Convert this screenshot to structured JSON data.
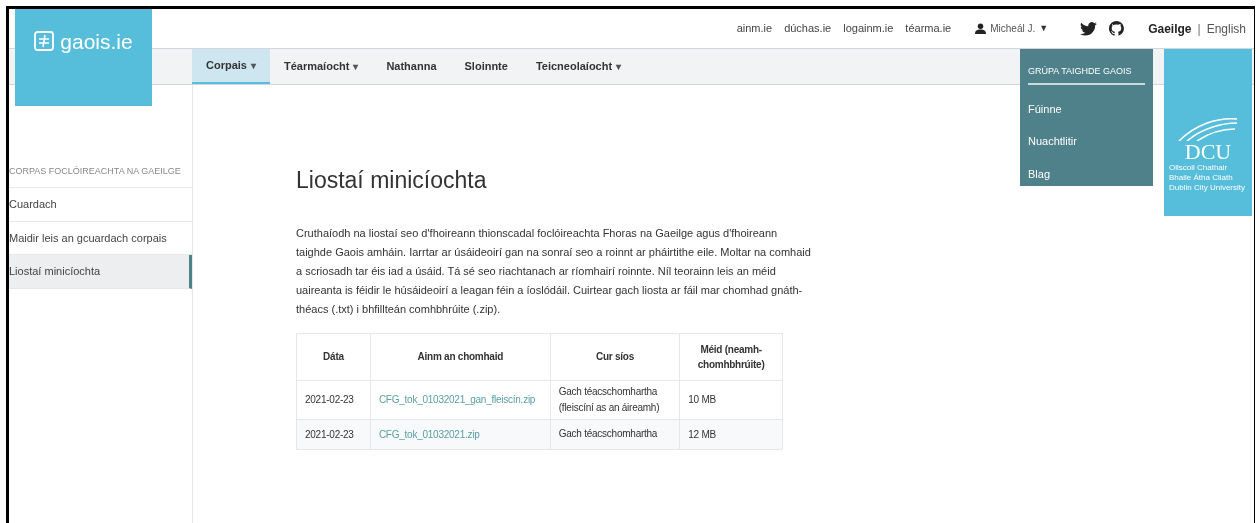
{
  "logo": {
    "text": "gaois.ie"
  },
  "top_links": [
    "ainm.ie",
    "dúchas.ie",
    "logainm.ie",
    "téarma.ie"
  ],
  "user": {
    "name": "Micheál J.",
    "caret": "▼"
  },
  "languages": [
    {
      "label": "Gaeilge",
      "selected": true
    },
    {
      "label": "English",
      "selected": false
    }
  ],
  "language_separator": "|",
  "nav": [
    {
      "label": "Corpais",
      "caret": "▾",
      "selected": true
    },
    {
      "label": "Téarmaíocht",
      "caret": "▾",
      "selected": false
    },
    {
      "label": "Nathanna",
      "selected": false
    },
    {
      "label": "Sloinnte",
      "selected": false
    },
    {
      "label": "Teicneolaíocht",
      "caret": "▾",
      "selected": false
    }
  ],
  "dropdown": {
    "heading": "GRÚPA TAIGHDE GAOIS",
    "items": [
      "Fúinne",
      "Nuachtlitir",
      "Blag"
    ]
  },
  "dcu_logo": {
    "text": "DCU",
    "lines": [
      "Ollscoil Chathair",
      "Bhaile Átha Cliath",
      "Dublin City University"
    ]
  },
  "sidebar": {
    "heading": "CORPAS FOCLÓIREACHTA NA GAEILGE",
    "items": [
      {
        "label": "Cuardach",
        "selected": false
      },
      {
        "label": "Maidir leis an gcuardach corpais",
        "selected": false
      },
      {
        "label": "Liostaí minicíochta",
        "selected": true
      }
    ]
  },
  "page_title": "Liostaí minicíochta",
  "intro": "Cruthaíodh na liostaí seo d'fhoireann thionscadal foclóireachta Fhoras na Gaeilge agus d'fhoireann taighde Gaois amháin. Iarrtar ar úsáideoirí gan na sonraí seo a roinnt ar pháirtithe eile. Moltar na comhaid a scriosadh tar éis iad a úsáid. Tá sé seo riachtanach ar ríomhairí roinnte. Níl teorainn leis an méid uaireanta is féidir le húsáideoirí a leagan féin a íoslódáil. Cuirtear gach liosta ar fáil mar chomhad gnáth-théacs (.txt) i bhfillteán comhbhrúite (.zip).",
  "table": {
    "columns": [
      "Dáta",
      "Ainm an chomhaid",
      "Cur síos",
      "Méid (neamh-chomhbhrúite)"
    ],
    "rows": [
      {
        "date": "2021-02-23",
        "file": "CFG_tok_01032021_gan_fleiscín.zip",
        "description": "Gach téacschomhartha (fleiscíní as an áireamh)",
        "size": "10 MB"
      },
      {
        "date": "2021-02-23",
        "file": "CFG_tok_01032021.zip",
        "description": "Gach téacschomhartha",
        "size": "12 MB"
      }
    ]
  }
}
